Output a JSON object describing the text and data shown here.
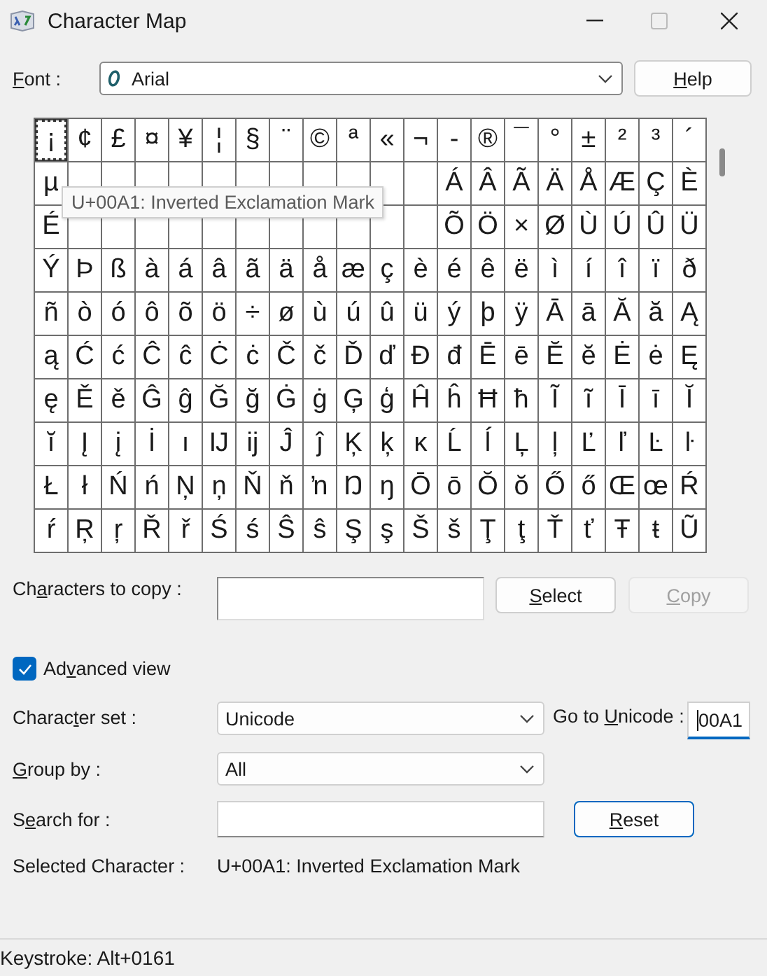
{
  "window": {
    "title": "Character Map"
  },
  "font_row": {
    "label": {
      "key": "F",
      "post": "ont :"
    },
    "value": "Arial",
    "help_button": {
      "key": "H",
      "post": "elp"
    }
  },
  "grid": {
    "rows": [
      [
        {
          "char": "¡",
          "selected": true
        },
        {
          "char": "¢",
          "selected": false
        },
        {
          "char": "£",
          "selected": false
        },
        {
          "char": "¤",
          "selected": false
        },
        {
          "char": "¥",
          "selected": false
        },
        {
          "char": "¦",
          "selected": false
        },
        {
          "char": "§",
          "selected": false
        },
        {
          "char": "¨",
          "selected": false
        },
        {
          "char": "©",
          "selected": false
        },
        {
          "char": "ª",
          "selected": false
        },
        {
          "char": "«",
          "selected": false
        },
        {
          "char": "¬",
          "selected": false
        },
        {
          "char": "-",
          "selected": false
        },
        {
          "char": "®",
          "selected": false
        },
        {
          "char": "¯",
          "selected": false
        },
        {
          "char": "°",
          "selected": false
        },
        {
          "char": "±",
          "selected": false
        },
        {
          "char": "²",
          "selected": false
        },
        {
          "char": "³",
          "selected": false
        },
        {
          "char": "´",
          "selected": false
        }
      ],
      [
        {
          "char": "µ",
          "selected": false
        },
        {
          "selected": false
        },
        {
          "selected": false
        },
        {
          "selected": false
        },
        {
          "selected": false
        },
        {
          "selected": false
        },
        {
          "selected": false
        },
        {
          "selected": false
        },
        {
          "selected": false
        },
        {
          "selected": false
        },
        {
          "selected": false
        },
        {
          "selected": false
        },
        {
          "char": "Á",
          "selected": false
        },
        {
          "char": "Â",
          "selected": false
        },
        {
          "char": "Ã",
          "selected": false
        },
        {
          "char": "Ä",
          "selected": false
        },
        {
          "char": "Å",
          "selected": false
        },
        {
          "char": "Æ",
          "selected": false
        },
        {
          "char": "Ç",
          "selected": false
        },
        {
          "char": "È",
          "selected": false
        }
      ],
      [
        {
          "char": "É",
          "selected": false
        },
        {
          "selected": false
        },
        {
          "selected": false
        },
        {
          "selected": false
        },
        {
          "selected": false
        },
        {
          "selected": false
        },
        {
          "selected": false
        },
        {
          "selected": false
        },
        {
          "selected": false
        },
        {
          "selected": false
        },
        {
          "selected": false
        },
        {
          "selected": false
        },
        {
          "char": "Õ",
          "selected": false
        },
        {
          "char": "Ö",
          "selected": false
        },
        {
          "char": "×",
          "selected": false
        },
        {
          "char": "Ø",
          "selected": false
        },
        {
          "char": "Ù",
          "selected": false
        },
        {
          "char": "Ú",
          "selected": false
        },
        {
          "char": "Û",
          "selected": false
        },
        {
          "char": "Ü",
          "selected": false
        }
      ],
      [
        {
          "char": "Ý",
          "selected": false
        },
        {
          "char": "Þ",
          "selected": false
        },
        {
          "char": "ß",
          "selected": false
        },
        {
          "char": "à",
          "selected": false
        },
        {
          "char": "á",
          "selected": false
        },
        {
          "char": "â",
          "selected": false
        },
        {
          "char": "ã",
          "selected": false
        },
        {
          "char": "ä",
          "selected": false
        },
        {
          "char": "å",
          "selected": false
        },
        {
          "char": "æ",
          "selected": false
        },
        {
          "char": "ç",
          "selected": false
        },
        {
          "char": "è",
          "selected": false
        },
        {
          "char": "é",
          "selected": false
        },
        {
          "char": "ê",
          "selected": false
        },
        {
          "char": "ë",
          "selected": false
        },
        {
          "char": "ì",
          "selected": false
        },
        {
          "char": "í",
          "selected": false
        },
        {
          "char": "î",
          "selected": false
        },
        {
          "char": "ï",
          "selected": false
        },
        {
          "char": "ð",
          "selected": false
        }
      ],
      [
        {
          "char": "ñ",
          "selected": false
        },
        {
          "char": "ò",
          "selected": false
        },
        {
          "char": "ó",
          "selected": false
        },
        {
          "char": "ô",
          "selected": false
        },
        {
          "char": "õ",
          "selected": false
        },
        {
          "char": "ö",
          "selected": false
        },
        {
          "char": "÷",
          "selected": false
        },
        {
          "char": "ø",
          "selected": false
        },
        {
          "char": "ù",
          "selected": false
        },
        {
          "char": "ú",
          "selected": false
        },
        {
          "char": "û",
          "selected": false
        },
        {
          "char": "ü",
          "selected": false
        },
        {
          "char": "ý",
          "selected": false
        },
        {
          "char": "þ",
          "selected": false
        },
        {
          "char": "ÿ",
          "selected": false
        },
        {
          "char": "Ā",
          "selected": false
        },
        {
          "char": "ā",
          "selected": false
        },
        {
          "char": "Ă",
          "selected": false
        },
        {
          "char": "ă",
          "selected": false
        },
        {
          "char": "Ą",
          "selected": false
        }
      ],
      [
        {
          "char": "ą",
          "selected": false
        },
        {
          "char": "Ć",
          "selected": false
        },
        {
          "char": "ć",
          "selected": false
        },
        {
          "char": "Ĉ",
          "selected": false
        },
        {
          "char": "ĉ",
          "selected": false
        },
        {
          "char": "Ċ",
          "selected": false
        },
        {
          "char": "ċ",
          "selected": false
        },
        {
          "char": "Č",
          "selected": false
        },
        {
          "char": "č",
          "selected": false
        },
        {
          "char": "Ď",
          "selected": false
        },
        {
          "char": "ď",
          "selected": false
        },
        {
          "char": "Đ",
          "selected": false
        },
        {
          "char": "đ",
          "selected": false
        },
        {
          "char": "Ē",
          "selected": false
        },
        {
          "char": "ē",
          "selected": false
        },
        {
          "char": "Ĕ",
          "selected": false
        },
        {
          "char": "ĕ",
          "selected": false
        },
        {
          "char": "Ė",
          "selected": false
        },
        {
          "char": "ė",
          "selected": false
        },
        {
          "char": "Ę",
          "selected": false
        }
      ],
      [
        {
          "char": "ę",
          "selected": false
        },
        {
          "char": "Ě",
          "selected": false
        },
        {
          "char": "ě",
          "selected": false
        },
        {
          "char": "Ĝ",
          "selected": false
        },
        {
          "char": "ĝ",
          "selected": false
        },
        {
          "char": "Ğ",
          "selected": false
        },
        {
          "char": "ğ",
          "selected": false
        },
        {
          "char": "Ġ",
          "selected": false
        },
        {
          "char": "ġ",
          "selected": false
        },
        {
          "char": "Ģ",
          "selected": false
        },
        {
          "char": "ģ",
          "selected": false
        },
        {
          "char": "Ĥ",
          "selected": false
        },
        {
          "char": "ĥ",
          "selected": false
        },
        {
          "char": "Ħ",
          "selected": false
        },
        {
          "char": "ħ",
          "selected": false
        },
        {
          "char": "Ĩ",
          "selected": false
        },
        {
          "char": "ĩ",
          "selected": false
        },
        {
          "char": "Ī",
          "selected": false
        },
        {
          "char": "ī",
          "selected": false
        },
        {
          "char": "Ĭ",
          "selected": false
        }
      ],
      [
        {
          "char": "ĭ",
          "selected": false
        },
        {
          "char": "Į",
          "selected": false
        },
        {
          "char": "į",
          "selected": false
        },
        {
          "char": "İ",
          "selected": false
        },
        {
          "char": "ı",
          "selected": false
        },
        {
          "char": "Ĳ",
          "selected": false
        },
        {
          "char": "ĳ",
          "selected": false
        },
        {
          "char": "Ĵ",
          "selected": false
        },
        {
          "char": "ĵ",
          "selected": false
        },
        {
          "char": "Ķ",
          "selected": false
        },
        {
          "char": "ķ",
          "selected": false
        },
        {
          "char": "ĸ",
          "selected": false
        },
        {
          "char": "Ĺ",
          "selected": false
        },
        {
          "char": "ĺ",
          "selected": false
        },
        {
          "char": "Ļ",
          "selected": false
        },
        {
          "char": "ļ",
          "selected": false
        },
        {
          "char": "Ľ",
          "selected": false
        },
        {
          "char": "ľ",
          "selected": false
        },
        {
          "char": "Ŀ",
          "selected": false
        },
        {
          "char": "ŀ",
          "selected": false
        }
      ],
      [
        {
          "char": "Ł",
          "selected": false
        },
        {
          "char": "ł",
          "selected": false
        },
        {
          "char": "Ń",
          "selected": false
        },
        {
          "char": "ń",
          "selected": false
        },
        {
          "char": "Ņ",
          "selected": false
        },
        {
          "char": "ņ",
          "selected": false
        },
        {
          "char": "Ň",
          "selected": false
        },
        {
          "char": "ň",
          "selected": false
        },
        {
          "char": "ŉ",
          "selected": false
        },
        {
          "char": "Ŋ",
          "selected": false
        },
        {
          "char": "ŋ",
          "selected": false
        },
        {
          "char": "Ō",
          "selected": false
        },
        {
          "char": "ō",
          "selected": false
        },
        {
          "char": "Ŏ",
          "selected": false
        },
        {
          "char": "ŏ",
          "selected": false
        },
        {
          "char": "Ő",
          "selected": false
        },
        {
          "char": "ő",
          "selected": false
        },
        {
          "char": "Œ",
          "selected": false
        },
        {
          "char": "œ",
          "selected": false
        },
        {
          "char": "Ŕ",
          "selected": false
        }
      ],
      [
        {
          "char": "ŕ",
          "selected": false
        },
        {
          "char": "Ŗ",
          "selected": false
        },
        {
          "char": "ŗ",
          "selected": false
        },
        {
          "char": "Ř",
          "selected": false
        },
        {
          "char": "ř",
          "selected": false
        },
        {
          "char": "Ś",
          "selected": false
        },
        {
          "char": "ś",
          "selected": false
        },
        {
          "char": "Ŝ",
          "selected": false
        },
        {
          "char": "ŝ",
          "selected": false
        },
        {
          "char": "Ş",
          "selected": false
        },
        {
          "char": "ş",
          "selected": false
        },
        {
          "char": "Š",
          "selected": false
        },
        {
          "char": "š",
          "selected": false
        },
        {
          "char": "Ţ",
          "selected": false
        },
        {
          "char": "ţ",
          "selected": false
        },
        {
          "char": "Ť",
          "selected": false
        },
        {
          "char": "ť",
          "selected": false
        },
        {
          "char": "Ŧ",
          "selected": false
        },
        {
          "char": "ŧ",
          "selected": false
        },
        {
          "char": "Ũ",
          "selected": false
        }
      ]
    ],
    "tooltip": "U+00A1: Inverted Exclamation Mark"
  },
  "copy_row": {
    "label": {
      "pre": "Ch",
      "key": "a",
      "post": "racters to copy :"
    },
    "select_button": {
      "key": "S",
      "post": "elect",
      "disabled": false
    },
    "copy_button": {
      "key": "C",
      "post": "opy",
      "disabled": true
    }
  },
  "advanced_view": {
    "label": {
      "pre": "Ad",
      "key": "v",
      "post": "anced view"
    },
    "checked": true
  },
  "character_set": {
    "label": {
      "pre": "Charac",
      "key": "t",
      "post": "er set :"
    },
    "value": "Unicode"
  },
  "go_to_unicode": {
    "label": {
      "pre": "Go to ",
      "key": "U",
      "post": "nicode :"
    },
    "value": "00A1"
  },
  "group_by": {
    "label": {
      "key": "G",
      "post": "roup by :"
    },
    "value": "All"
  },
  "search_for": {
    "label": {
      "pre": "S",
      "key": "e",
      "post": "arch for :"
    },
    "reset_button": {
      "key": "R",
      "post": "eset",
      "disabled": false
    }
  },
  "selected_character": {
    "label": "Selected Character :",
    "value": "U+00A1: Inverted Exclamation Mark"
  },
  "status_bar": "Keystroke: Alt+0161"
}
